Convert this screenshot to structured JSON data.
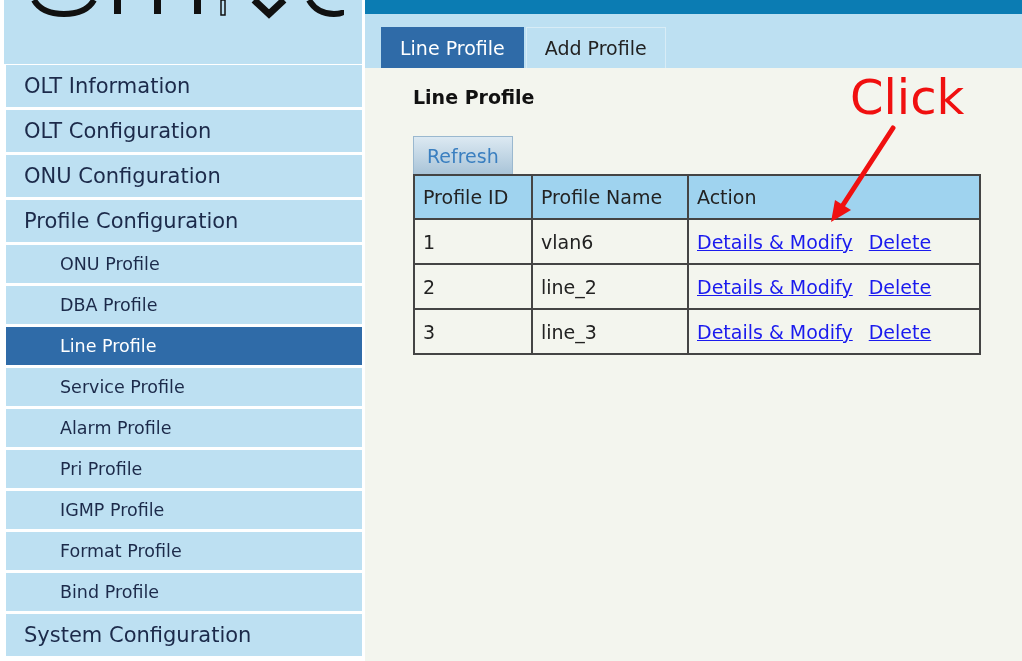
{
  "sidebar": {
    "items": [
      {
        "label": "OLT Information",
        "selected": false
      },
      {
        "label": "OLT Configuration",
        "selected": false
      },
      {
        "label": "ONU Configuration",
        "selected": false
      },
      {
        "label": "Profile Configuration",
        "selected": false,
        "children": [
          {
            "label": "ONU Profile",
            "selected": false
          },
          {
            "label": "DBA Profile",
            "selected": false
          },
          {
            "label": "Line Profile",
            "selected": true
          },
          {
            "label": "Service Profile",
            "selected": false
          },
          {
            "label": "Alarm Profile",
            "selected": false
          },
          {
            "label": "Pri Profile",
            "selected": false
          },
          {
            "label": "IGMP Profile",
            "selected": false
          },
          {
            "label": "Format Profile",
            "selected": false
          },
          {
            "label": "Bind Profile",
            "selected": false
          }
        ]
      },
      {
        "label": "System Configuration",
        "selected": false
      }
    ]
  },
  "tabs": [
    {
      "label": "Line Profile",
      "selected": true
    },
    {
      "label": "Add Profile",
      "selected": false
    }
  ],
  "content": {
    "title": "Line Profile",
    "refresh_button": "Refresh",
    "table": {
      "columns": [
        "Profile ID",
        "Profile Name",
        "Action"
      ],
      "rows": [
        {
          "id": "1",
          "name": "vlan6",
          "actions": [
            "Details & Modify",
            "Delete"
          ]
        },
        {
          "id": "2",
          "name": "line_2",
          "actions": [
            "Details & Modify",
            "Delete"
          ]
        },
        {
          "id": "3",
          "name": "line_3",
          "actions": [
            "Details & Modify",
            "Delete"
          ]
        }
      ]
    }
  },
  "annotation": {
    "text": "Click"
  }
}
